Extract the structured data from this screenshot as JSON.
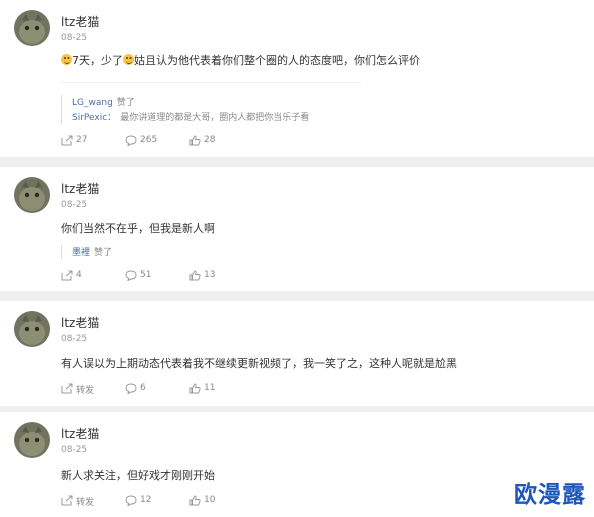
{
  "comments": [
    {
      "username": "ltz老猫",
      "date": "08-25",
      "text_a": "7天，少了",
      "text_b": "姑且认为他代表着你们整个圈的人的态度吧，你们怎么评价",
      "replies": [
        {
          "name": "LG_wang",
          "text": "赞了"
        },
        {
          "name": "SirPexic：",
          "text": "最你讲道理的都是大哥，圈内人都把你当乐子看"
        }
      ],
      "share": "27",
      "comment_count": "265",
      "likes": "28"
    },
    {
      "username": "ltz老猫",
      "date": "08-25",
      "text": "你们当然不在乎，但我是新人啊",
      "replies": [
        {
          "name": "墨裡",
          "text": "赞了"
        }
      ],
      "share": "4",
      "comment_count": "51",
      "likes": "13"
    },
    {
      "username": "ltz老猫",
      "date": "08-25",
      "text": "有人误以为上期动态代表着我不继续更新视频了，我一笑了之，这种人呢就是尬黑",
      "share": "转发",
      "comment_count": "6",
      "likes": "11"
    },
    {
      "username": "ltz老猫",
      "date": "08-25",
      "text": "新人求关注，但好戏才刚刚开始",
      "share": "转发",
      "comment_count": "12",
      "likes": "10"
    }
  ],
  "watermark": "欧漫露",
  "colors": {
    "background": "#efefef",
    "card": "#ffffff",
    "link": "#4a6fa5",
    "watermark": "#1f57b8"
  },
  "icons": [
    "share-icon",
    "comment-icon",
    "like-icon",
    "smiley-emoji"
  ]
}
